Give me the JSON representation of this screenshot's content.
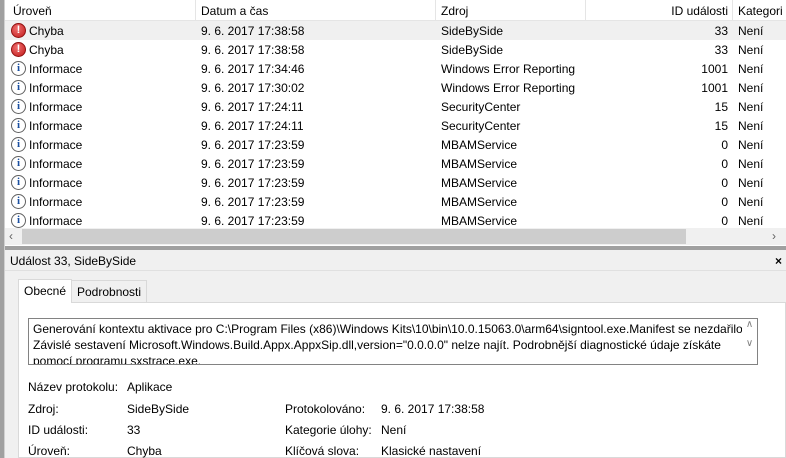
{
  "columns": [
    "Úroveň",
    "Datum a čas",
    "Zdroj",
    "ID události",
    "Kategori"
  ],
  "rows": [
    {
      "level": "Chyba",
      "type": "error",
      "date": "9. 6. 2017 17:38:58",
      "source": "SideBySide",
      "id": "33",
      "cat": "Není"
    },
    {
      "level": "Chyba",
      "type": "error",
      "date": "9. 6. 2017 17:38:58",
      "source": "SideBySide",
      "id": "33",
      "cat": "Není"
    },
    {
      "level": "Informace",
      "type": "info",
      "date": "9. 6. 2017 17:34:46",
      "source": "Windows Error Reporting",
      "id": "1001",
      "cat": "Není"
    },
    {
      "level": "Informace",
      "type": "info",
      "date": "9. 6. 2017 17:30:02",
      "source": "Windows Error Reporting",
      "id": "1001",
      "cat": "Není"
    },
    {
      "level": "Informace",
      "type": "info",
      "date": "9. 6. 2017 17:24:11",
      "source": "SecurityCenter",
      "id": "15",
      "cat": "Není"
    },
    {
      "level": "Informace",
      "type": "info",
      "date": "9. 6. 2017 17:24:11",
      "source": "SecurityCenter",
      "id": "15",
      "cat": "Není"
    },
    {
      "level": "Informace",
      "type": "info",
      "date": "9. 6. 2017 17:23:59",
      "source": "MBAMService",
      "id": "0",
      "cat": "Není"
    },
    {
      "level": "Informace",
      "type": "info",
      "date": "9. 6. 2017 17:23:59",
      "source": "MBAMService",
      "id": "0",
      "cat": "Není"
    },
    {
      "level": "Informace",
      "type": "info",
      "date": "9. 6. 2017 17:23:59",
      "source": "MBAMService",
      "id": "0",
      "cat": "Není"
    },
    {
      "level": "Informace",
      "type": "info",
      "date": "9. 6. 2017 17:23:59",
      "source": "MBAMService",
      "id": "0",
      "cat": "Není"
    },
    {
      "level": "Informace",
      "type": "info",
      "date": "9. 6. 2017 17:23:59",
      "source": "MBAMService",
      "id": "0",
      "cat": "Není"
    }
  ],
  "detail": {
    "title": "Událost 33, SideBySide",
    "close": "×",
    "tabs": [
      "Obecné",
      "Podrobnosti"
    ],
    "message": "Generování kontextu aktivace pro C:\\Program Files (x86)\\Windows Kits\\10\\bin\\10.0.15063.0\\arm64\\signtool.exe.Manifest se nezdařilo. Závislé sestavení Microsoft.Windows.Build.Appx.AppxSip.dll,version=\"0.0.0.0\" nelze najít. Podrobnější diagnostické údaje získáte pomocí programu sxstrace.exe.",
    "fields": {
      "log_label": "Název protokolu:",
      "log": "Aplikace",
      "source_label": "Zdroj:",
      "source": "SideBySide",
      "logged_label": "Protokolováno:",
      "logged": "9. 6. 2017 17:38:58",
      "id_label": "ID události:",
      "id": "33",
      "task_label": "Kategorie úlohy:",
      "task": "Není",
      "level_label": "Úroveň:",
      "level": "Chyba",
      "keywords_label": "Klíčová slova:",
      "keywords": "Klasické nastavení"
    }
  }
}
